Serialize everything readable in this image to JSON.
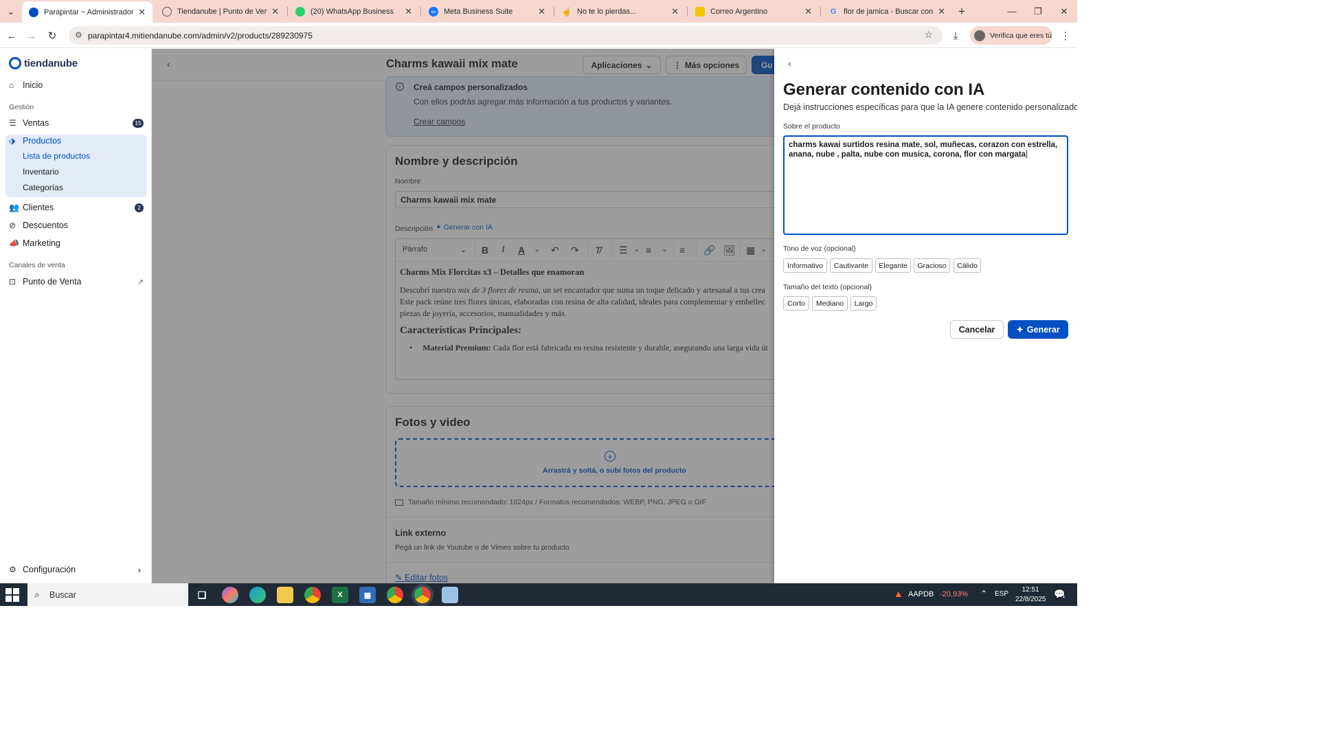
{
  "browser": {
    "tabs": [
      {
        "title": "Parapintar ~ Administrador Nu",
        "active": true,
        "color": "#0050c3"
      },
      {
        "title": "Tiendanube | Punto de Venta",
        "active": false,
        "color": "#ffffff"
      },
      {
        "title": "(20) WhatsApp Business",
        "active": false,
        "color": "#25d366"
      },
      {
        "title": "Meta Business Suite",
        "active": false,
        "color": "#1877f2"
      },
      {
        "title": "No te lo pierdas...",
        "active": false,
        "color": "#ffffff"
      },
      {
        "title": "Correo Argentino",
        "active": false,
        "color": "#f5c400"
      },
      {
        "title": "flor de jamica - Buscar con Goo",
        "active": false,
        "color": "#ffffff"
      }
    ],
    "url": "parapintar4.mitiendanube.com/admin/v2/products/289230975",
    "verify_label": "Verifica que eres tú"
  },
  "sidebar": {
    "brand": "tiendanube",
    "home": "Inicio",
    "section_gestion": "Gestión",
    "ventas": "Ventas",
    "ventas_badge": "15",
    "productos": "Productos",
    "productos_sub": [
      "Lista de productos",
      "Inventario",
      "Categorías"
    ],
    "clientes": "Clientes",
    "clientes_badge": "2",
    "descuentos": "Descuentos",
    "marketing": "Marketing",
    "section_canales": "Canales de venta",
    "punto_venta": "Punto de Venta",
    "configuracion": "Configuración"
  },
  "header": {
    "title": "Charms kawaii mix mate",
    "apps_label": "Aplicaciones",
    "more_label": "Más opciones",
    "save_label": "Gu"
  },
  "info_card": {
    "title": "Creá campos personalizados",
    "text": "Con ellos podrás agregar más información a tus productos y variantes.",
    "link": "Crear campos"
  },
  "name_card": {
    "title": "Nombre y descripción",
    "name_label": "Nombre",
    "name_value": "Charms kawaii mix mate",
    "desc_label": "Descripción",
    "gen_ia": "Generar con IA",
    "paragraph_select": "Párrafo",
    "editor": {
      "heading": "Charms Mix Florcitas x3 – Detalles que enamoran",
      "p1_a": "Descubrí nuestro ",
      "p1_em": "mix de 3 flores de resina",
      "p1_b": ", un set encantador que suma un toque delicado y artesanal a tus crea",
      "p2": "Este pack reúne tres flores únicas, elaboradas con resina de alta calidad, ideales para complementar y embellec",
      "p3": "piezas de joyería, accesorios, manualidades y más.",
      "h2": "Características Principales:",
      "li1_b": "Material Premium:",
      "li1": " Cada flor está fabricada en resina resistente y durable, asegurando una larga vida út"
    }
  },
  "photos_card": {
    "title": "Fotos y video",
    "drop_text": "Arrastrá y soltá, o subí fotos del producto",
    "hint": "Tamaño mínimo recomendado: 1024px / Formatos recomendados: WEBP, PNG, JPEG o GIF",
    "link_title": "Link externo",
    "link_text": "Pegá un link de Youtube o de Vimeo sobre tu producto",
    "edit_link": "Editar fotos"
  },
  "drawer": {
    "title": "Generar contenido con IA",
    "subtitle": "Dejá instrucciones específicas para que la IA genere contenido personalizado.",
    "about_label": "Sobre el producto",
    "about_value": "charms kawai surtidos resina mate, sol, muñecas, corazon con estrella, anana, nube , palta, nube con musica, corona, flor con margata",
    "tone_label": "Tono de voz (opcional)",
    "tones": [
      "Informativo",
      "Cautivante",
      "Elegante",
      "Gracioso",
      "Cálido"
    ],
    "size_label": "Tamaño del texto (opcional)",
    "sizes": [
      "Corto",
      "Mediano",
      "Largo"
    ],
    "cancel": "Cancelar",
    "generate": "Generar"
  },
  "taskbar": {
    "search": "Buscar",
    "stock": "AAPDB",
    "stock_change": "-20,93%",
    "lang": "ESP",
    "time": "12:51",
    "date": "22/8/2025",
    "notif_count": "1"
  }
}
